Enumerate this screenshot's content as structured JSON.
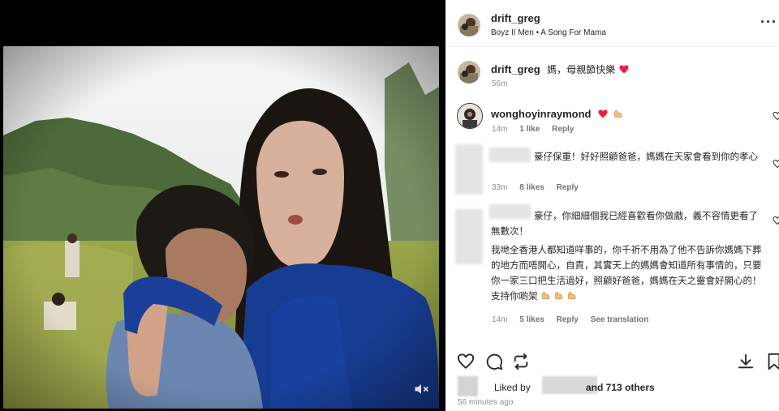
{
  "post": {
    "username": "drift_greg",
    "audio": "Boyz II Men • A Song For Mama",
    "more_icon": "more-horizontal-icon"
  },
  "caption": {
    "username": "drift_greg",
    "text": "媽，母親節快樂",
    "time": "56m"
  },
  "comments": [
    {
      "username": "wonghoyinraymond",
      "text": "",
      "time": "14m",
      "likes": "1 like",
      "reply": "Reply"
    },
    {
      "username": "",
      "text": "豪仔保重！好好照顧爸爸，媽媽在天家會看到你的孝心",
      "time": "33m",
      "likes": "8 likes",
      "reply": "Reply"
    },
    {
      "username": "",
      "text_lines": [
        "豪仔，你細細個我已經喜歡看你做戲，義不容情更看了無數次！",
        "我哋全香港人都知道咩事的，你千祈不用為了他不告訴你媽媽下葬的地方而唔開心，自責，其實天上的媽媽會知道所有事情的，只要你一家三口把生活過好，照顧好爸爸，媽媽在天之靈會好開心的！",
        "支持你啲架"
      ],
      "time": "14m",
      "likes": "5 likes",
      "reply": "Reply",
      "translation": "See translation"
    }
  ],
  "likes": {
    "prefix": "Liked by",
    "count": "and 713 others"
  },
  "post_time": "56 minutes ago",
  "colors": {
    "heart": "#ed1c3b",
    "muted": "#8e8e8e",
    "text": "#262626",
    "emoji": "#f6c27a"
  }
}
